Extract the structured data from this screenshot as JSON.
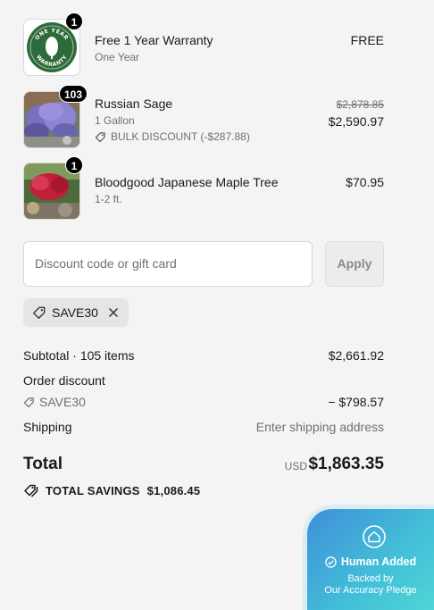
{
  "items": [
    {
      "name": "Free 1 Year Warranty",
      "variant": "One Year",
      "quantity": "1",
      "price": "FREE",
      "image_icon": "warranty-seal-icon",
      "seal_text_top": "ONE YEAR",
      "seal_text_bottom": "WARRANTY"
    },
    {
      "name": "Russian Sage",
      "variant": "1 Gallon",
      "quantity": "103",
      "compare_price": "$2,878.85",
      "price": "$2,590.97",
      "discount_label": "BULK DISCOUNT (-$287.88)",
      "image_icon": "russian-sage-photo"
    },
    {
      "name": "Bloodgood Japanese Maple Tree",
      "variant": "1-2 ft.",
      "quantity": "1",
      "price": "$70.95",
      "image_icon": "japanese-maple-photo"
    }
  ],
  "discount": {
    "placeholder": "Discount code or gift card",
    "apply_label": "Apply",
    "applied_code": "SAVE30"
  },
  "summary": {
    "subtotal_label": "Subtotal · 105 items",
    "subtotal_value": "$2,661.92",
    "order_discount_label": "Order discount",
    "order_discount_code": "SAVE30",
    "order_discount_value": "− $798.57",
    "shipping_label": "Shipping",
    "shipping_value": "Enter shipping address",
    "total_label": "Total",
    "total_currency": "USD",
    "total_value": "$1,863.35",
    "savings_label": "TOTAL SAVINGS",
    "savings_value": "$1,086.45"
  },
  "trust_badge": {
    "title": "Human Added",
    "line1": "Backed by",
    "line2": "Our Accuracy Pledge"
  },
  "colors": {
    "badge_gradient_start": "#3f8fd9",
    "badge_gradient_end": "#4fd5d6",
    "seal_green": "#2e6b3a"
  }
}
